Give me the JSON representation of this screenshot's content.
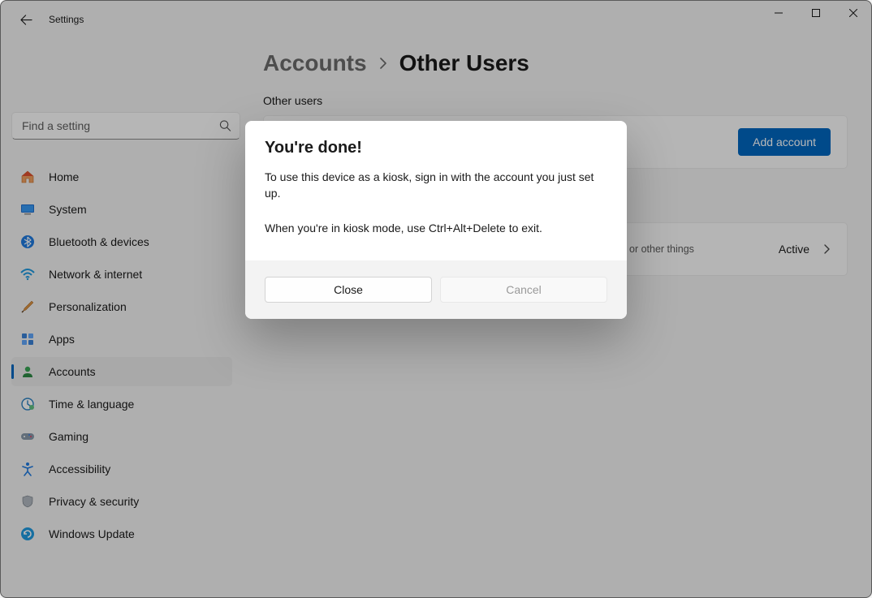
{
  "window": {
    "title": "Settings"
  },
  "search": {
    "placeholder": "Find a setting"
  },
  "nav": {
    "items": [
      {
        "label": "Home"
      },
      {
        "label": "System"
      },
      {
        "label": "Bluetooth & devices"
      },
      {
        "label": "Network & internet"
      },
      {
        "label": "Personalization"
      },
      {
        "label": "Apps"
      },
      {
        "label": "Accounts"
      },
      {
        "label": "Time & language"
      },
      {
        "label": "Gaming"
      },
      {
        "label": "Accessibility"
      },
      {
        "label": "Privacy & security"
      },
      {
        "label": "Windows Update"
      }
    ]
  },
  "breadcrumb": {
    "parent": "Accounts",
    "current": "Other Users"
  },
  "main": {
    "section_title": "Other users",
    "add_account_label": "Add account",
    "kiosk_desc_partial": "or other things",
    "kiosk_status": "Active"
  },
  "modal": {
    "title": "You're done!",
    "line1": "To use this device as a kiosk, sign in with the account you just set up.",
    "line2": "When you're in kiosk mode, use Ctrl+Alt+Delete to exit.",
    "close": "Close",
    "cancel": "Cancel"
  }
}
